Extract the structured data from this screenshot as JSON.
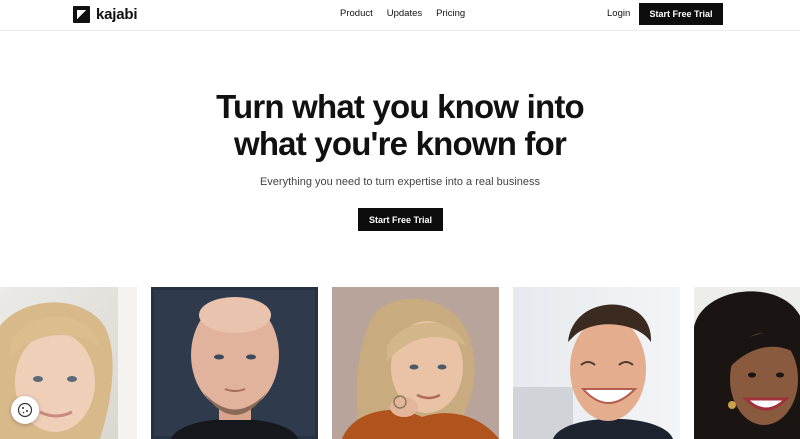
{
  "brand": {
    "name": "kajabi"
  },
  "nav": {
    "links": [
      "Product",
      "Updates",
      "Pricing"
    ],
    "login": "Login",
    "cta": "Start Free Trial"
  },
  "hero": {
    "title_line1": "Turn what you know into",
    "title_line2": "what you're known for",
    "subtitle": "Everything you need to turn expertise into a real business",
    "cta": "Start Free Trial"
  },
  "portraits": [
    "blonde-woman",
    "bald-man",
    "older-woman",
    "smiling-man",
    "curly-hair-woman"
  ],
  "colors": {
    "primary": "#0d0d0d",
    "background": "#ffffff",
    "text": "#111111"
  },
  "icons": {
    "cookie": "cookie-icon"
  }
}
